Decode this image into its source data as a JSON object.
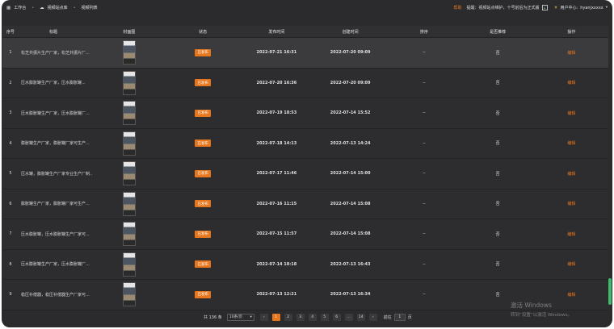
{
  "topbar": {
    "breadcrumb": [
      "工作台",
      "视频站点库",
      "视频列表"
    ],
    "help": "帮助",
    "notice": "提醒：视频站点维护，十号前后为正式版",
    "user_label": "用户中心:",
    "username": "hyanjxxxxx"
  },
  "table": {
    "columns": [
      "序号",
      "标题",
      "封面图",
      "状态",
      "发布时间",
      "创建时间",
      "排序",
      "是否推荐",
      "操作"
    ],
    "rows": [
      {
        "index": "1",
        "title": "松芝共振片生产厂家，松芝共振片厂...",
        "status": "已发布",
        "publish_time": "2022-07-21 16:31",
        "create_time": "2022-07-20 09:09",
        "sort": "--",
        "recommend": "否",
        "action": "编辑"
      },
      {
        "index": "2",
        "title": "压水膨胀罐生产厂家，压水膨胀罐...",
        "status": "已发布",
        "publish_time": "2022-07-20 16:36",
        "create_time": "2022-07-20 09:09",
        "sort": "--",
        "recommend": "否",
        "action": "编辑"
      },
      {
        "index": "3",
        "title": "压水膨胀罐生产厂家，压水膨胀罐厂...",
        "status": "已发布",
        "publish_time": "2022-07-19 18:53",
        "create_time": "2022-07-14 15:52",
        "sort": "--",
        "recommend": "否",
        "action": "编辑"
      },
      {
        "index": "4",
        "title": "膨胀罐生产厂家，膨胀罐厂家可生产...",
        "status": "已发布",
        "publish_time": "2022-07-18 14:13",
        "create_time": "2022-07-13 14:24",
        "sort": "--",
        "recommend": "否",
        "action": "编辑"
      },
      {
        "index": "5",
        "title": "压水罐，膨胀罐生产厂家专业生产厂制...",
        "status": "已发布",
        "publish_time": "2022-07-17 11:46",
        "create_time": "2022-07-14 15:00",
        "sort": "--",
        "recommend": "否",
        "action": "编辑"
      },
      {
        "index": "6",
        "title": "膨胀罐生产厂家，膨胀罐厂家可生产...",
        "status": "已发布",
        "publish_time": "2022-07-16 11:15",
        "create_time": "2022-07-14 15:08",
        "sort": "--",
        "recommend": "否",
        "action": "编辑"
      },
      {
        "index": "7",
        "title": "压水膨胀罐，压水膨胀罐生产厂家可...",
        "status": "已发布",
        "publish_time": "2022-07-15 11:57",
        "create_time": "2022-07-14 15:08",
        "sort": "--",
        "recommend": "否",
        "action": "编辑"
      },
      {
        "index": "8",
        "title": "压水膨胀罐生产厂家，压水膨胀罐厂...",
        "status": "已发布",
        "publish_time": "2022-07-14 18:18",
        "create_time": "2022-07-13 16:43",
        "sort": "--",
        "recommend": "否",
        "action": "编辑"
      },
      {
        "index": "9",
        "title": "稳压补偿器，稳压补偿器生产厂家可...",
        "status": "已发布",
        "publish_time": "2022-07-13 12:21",
        "create_time": "2022-07-13 16:34",
        "sort": "--",
        "recommend": "否",
        "action": "编辑"
      }
    ]
  },
  "pagination": {
    "total": "共 136 条",
    "page_size": "10条/页",
    "prev": "‹",
    "next": "›",
    "pages": [
      "1",
      "2",
      "3",
      "4",
      "5",
      "6",
      "...",
      "14"
    ],
    "goto_label": "前往",
    "goto_value": "1",
    "page_unit": "页"
  },
  "watermark": {
    "line1": "激活 Windows",
    "line2": "转到“设置”以激活 Windows。"
  },
  "icons": {
    "breadcrumb_home": "grid-icon",
    "breadcrumb_site": "cloud-icon",
    "notice_download": "download-icon",
    "user": "sun-icon",
    "dropdown": "chevron-down-icon"
  },
  "colors": {
    "accent": "#e8761c",
    "background": "#2b2b2d",
    "highlight_row": "#3b3b3e",
    "scrollbar": "#3dbb6a"
  }
}
